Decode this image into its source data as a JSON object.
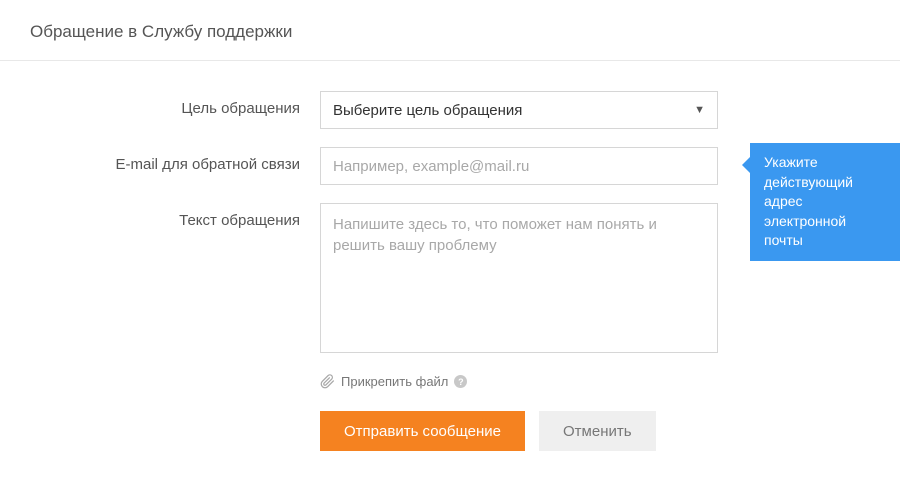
{
  "header": {
    "title": "Обращение в Службу поддержки"
  },
  "form": {
    "purpose": {
      "label": "Цель обращения",
      "selected": "Выберите цель обращения"
    },
    "email": {
      "label": "E-mail для обратной связи",
      "placeholder": "Например, example@mail.ru",
      "value": ""
    },
    "message": {
      "label": "Текст обращения",
      "placeholder": "Напишите здесь то, что поможет нам понять и решить вашу проблему",
      "value": ""
    },
    "attach": {
      "label": "Прикрепить файл"
    },
    "buttons": {
      "submit": "Отправить сообщение",
      "cancel": "Отменить"
    }
  },
  "tooltip": {
    "text": "Укажите действующий адрес электронной почты"
  }
}
